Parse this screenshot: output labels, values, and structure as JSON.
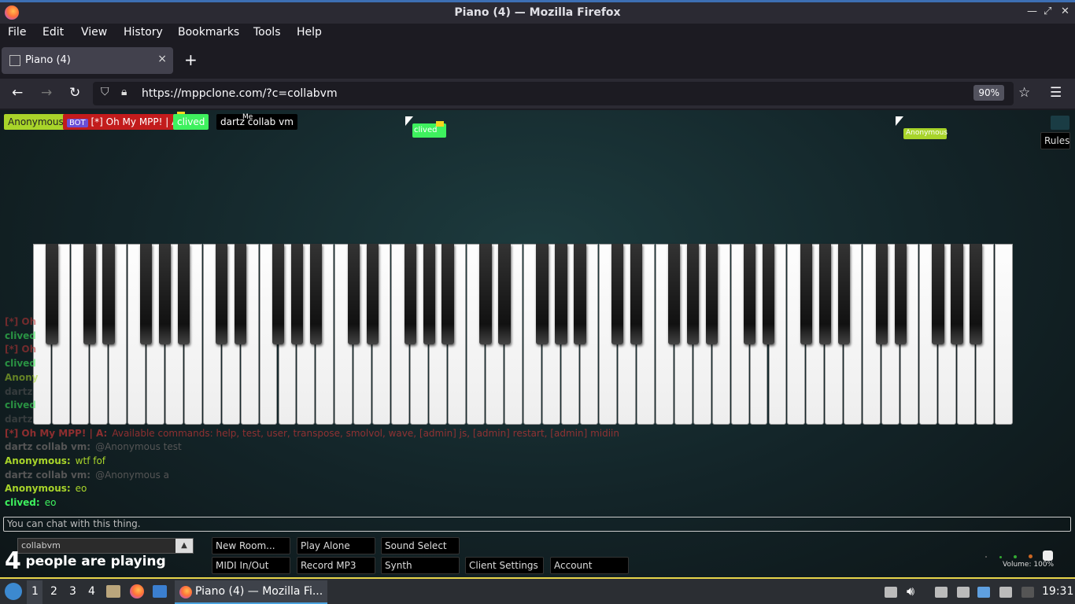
{
  "window": {
    "title": "Piano (4) — Mozilla Firefox"
  },
  "menu": [
    "File",
    "Edit",
    "View",
    "History",
    "Bookmarks",
    "Tools",
    "Help"
  ],
  "tab": {
    "label": "Piano (4)",
    "close": "×",
    "new": "+"
  },
  "nav": {
    "url": "https://mppclone.com/?c=collabvm",
    "zoom": "90%"
  },
  "players": [
    {
      "name": "Anonymous",
      "color": "#a8d42a",
      "text_color": "#222"
    },
    {
      "badge": "BOT",
      "name": "[*] Oh My MPP! | A",
      "color": "#c21c1c",
      "text_color": "#fff"
    },
    {
      "name": "clived",
      "color": "#3ef15e",
      "text_color": "#fff"
    },
    {
      "name": "dartz collab vm",
      "color": "#000000",
      "text_color": "#fff",
      "me": "Me"
    }
  ],
  "cursors": [
    {
      "name": "clived",
      "color": "#3ef15e"
    },
    {
      "name": "Anonymous",
      "color": "#a8d42a"
    }
  ],
  "rules_label": "Rules",
  "chat": [
    {
      "name": "[*] Oh",
      "text": "",
      "color": "#c23636"
    },
    {
      "name": "clived",
      "text": "",
      "color": "#3ef15e"
    },
    {
      "name": "[*] Oh",
      "text": "",
      "color": "#c23636"
    },
    {
      "name": "clived",
      "text": "",
      "color": "#3ef15e"
    },
    {
      "name": "Anony",
      "text": "",
      "color": "#a8d42a"
    },
    {
      "name": "dartz",
      "text": "",
      "color": "#555"
    },
    {
      "name": "clived",
      "text": "",
      "color": "#3ef15e"
    },
    {
      "name": "dartz",
      "text": "",
      "color": "#555"
    },
    {
      "name": "[*] Oh My MPP! | A:",
      "text": "Available commands: help, test, user, transpose, smolvol, wave, [admin] js, [admin] restart, [admin] midiin",
      "color": "#c23636"
    },
    {
      "name": "dartz collab vm:",
      "text": "@Anonymous test",
      "color": "#555"
    },
    {
      "name": "Anonymous:",
      "text": "wtf fof",
      "color": "#a8d42a"
    },
    {
      "name": "dartz collab vm:",
      "text": "@Anonymous a",
      "color": "#555"
    },
    {
      "name": "Anonymous:",
      "text": "eo",
      "color": "#a8d42a"
    },
    {
      "name": "clived:",
      "text": "eo",
      "color": "#3ef15e"
    }
  ],
  "chat_placeholder": "You can chat with this thing.",
  "room": "collabvm",
  "buttons": {
    "new_room": "New Room...",
    "play_alone": "Play Alone",
    "sound_select": "Sound Select",
    "midi": "MIDI In/Out",
    "record": "Record MP3",
    "synth": "Synth",
    "client_settings": "Client Settings",
    "account": "Account"
  },
  "playing": {
    "count": "4",
    "text": "people are playing"
  },
  "volume": "Volume: 100%",
  "taskbar": {
    "workspaces": [
      "1",
      "2",
      "3",
      "4"
    ],
    "task": "Piano (4) — Mozilla Fi...",
    "clock": "19:31"
  },
  "icons": {
    "firefox": "firefox-icon",
    "back": "arrow-left-icon",
    "forward": "arrow-right-icon",
    "reload": "reload-icon",
    "shield": "shield-icon",
    "lock": "lock-icon",
    "star": "star-icon",
    "hamburger": "hamburger-menu-icon"
  }
}
